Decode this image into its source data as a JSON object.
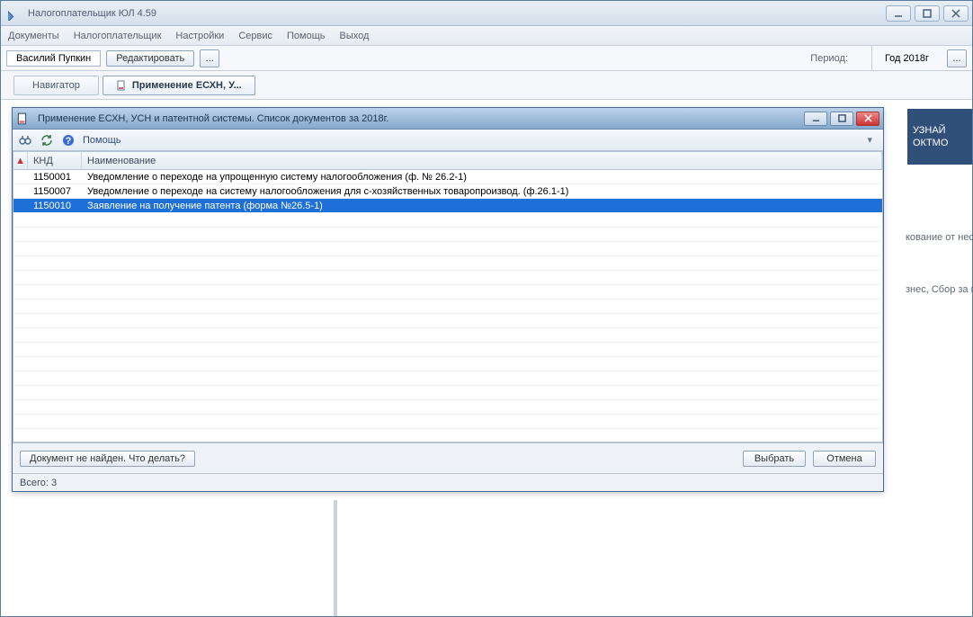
{
  "app": {
    "title": "Налогоплательщик ЮЛ 4.59"
  },
  "menu": {
    "documents": "Документы",
    "taxpayer": "Налогоплательщик",
    "settings": "Настройки",
    "service": "Сервис",
    "help": "Помощь",
    "exit": "Выход"
  },
  "toolbar": {
    "user": "Василий Пупкин",
    "edit_label": "Редактировать",
    "more_label": "...",
    "period_label": "Период:",
    "period_value": "Год 2018г",
    "more2_label": "..."
  },
  "tabs": {
    "navigator": "Навигатор",
    "active": "Применение ЕСХН, У..."
  },
  "side": {
    "line1": "УЗНАЙ",
    "line2": "ОКТМО"
  },
  "bg": {
    "text1": "кование от несчаст",
    "text2": "знес, Сбор за польз"
  },
  "dialog": {
    "title": "Применение ЕСХН, УСН и патентной системы. Список документов за 2018г.",
    "help": "Помощь",
    "columns": {
      "sort_indicator": "▲",
      "knd": "КНД",
      "name": "Наименование"
    },
    "rows": [
      {
        "knd": "1150001",
        "name": "Уведомление о переходе на упрощенную систему налогообложения (ф. № 26.2-1)",
        "selected": false
      },
      {
        "knd": "1150007",
        "name": "Уведомление  о переходе на систему налогообложения  для с-хозяйственных товаропроизвод. (ф.26.1-1)",
        "selected": false
      },
      {
        "knd": "1150010",
        "name": "Заявление на получение патента (форма №26.5-1)",
        "selected": true
      }
    ],
    "not_found": "Документ не найден. Что делать?",
    "select": "Выбрать",
    "cancel": "Отмена",
    "status": "Всего: 3"
  }
}
